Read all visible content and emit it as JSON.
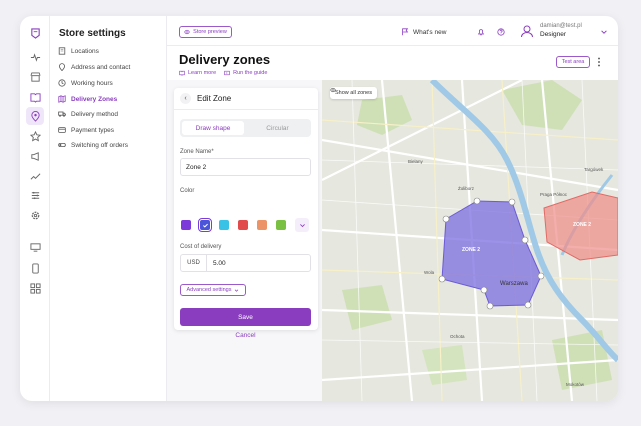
{
  "sidebar": {
    "title": "Store settings",
    "items": [
      {
        "label": "Locations",
        "icon": "building-icon"
      },
      {
        "label": "Address and contact",
        "icon": "pin-icon"
      },
      {
        "label": "Working hours",
        "icon": "clock-icon"
      },
      {
        "label": "Delivery Zones",
        "icon": "map-icon",
        "active": true
      },
      {
        "label": "Delivery method",
        "icon": "truck-icon"
      },
      {
        "label": "Payment types",
        "icon": "card-icon"
      },
      {
        "label": "Switching off orders",
        "icon": "toggle-icon"
      }
    ]
  },
  "rail": {
    "icons": [
      "logo-icon",
      "activity-icon",
      "store-icon",
      "book-icon",
      "location-icon",
      "star-icon",
      "megaphone-icon",
      "trend-icon",
      "sliders-icon",
      "gear-icon",
      "monitor-icon",
      "phone-icon",
      "grid-icon"
    ],
    "active": "location-icon"
  },
  "topbar": {
    "store_preview": "Store preview",
    "whats_new": "What's new",
    "user_email": "damian@test.pl",
    "user_role": "Designer"
  },
  "header": {
    "title": "Delivery zones",
    "learn_more": "Learn more",
    "run_guide": "Run the guide",
    "test_area": "Test area"
  },
  "panel": {
    "title": "Edit Zone",
    "tab_draw": "Draw shape",
    "tab_circular": "Circular",
    "zone_name_label": "Zone Name*",
    "zone_name_value": "Zone 2",
    "color_label": "Color",
    "colors": [
      "#7b3ad9",
      "#4a55d8",
      "#39c2e6",
      "#e14b4b",
      "#ec9468",
      "#7ac043"
    ],
    "selected_color": "#4a55d8",
    "cost_label": "Cost of delivery",
    "currency": "USD",
    "cost_value": "5.00",
    "advanced": "Advanced settings",
    "save": "Save",
    "cancel": "Cancel"
  },
  "map": {
    "show_all": "Show all zones",
    "zone_a": "ZONE 2",
    "zone_b": "ZONE 2",
    "zone_a_color": "#7b6ee0",
    "zone_b_color": "#ef8c88",
    "places": [
      "Bielany",
      "Żoliborz",
      "Praga Północ",
      "Targówek",
      "Wola",
      "Warszawa",
      "Ochota",
      "Mokotów"
    ]
  }
}
